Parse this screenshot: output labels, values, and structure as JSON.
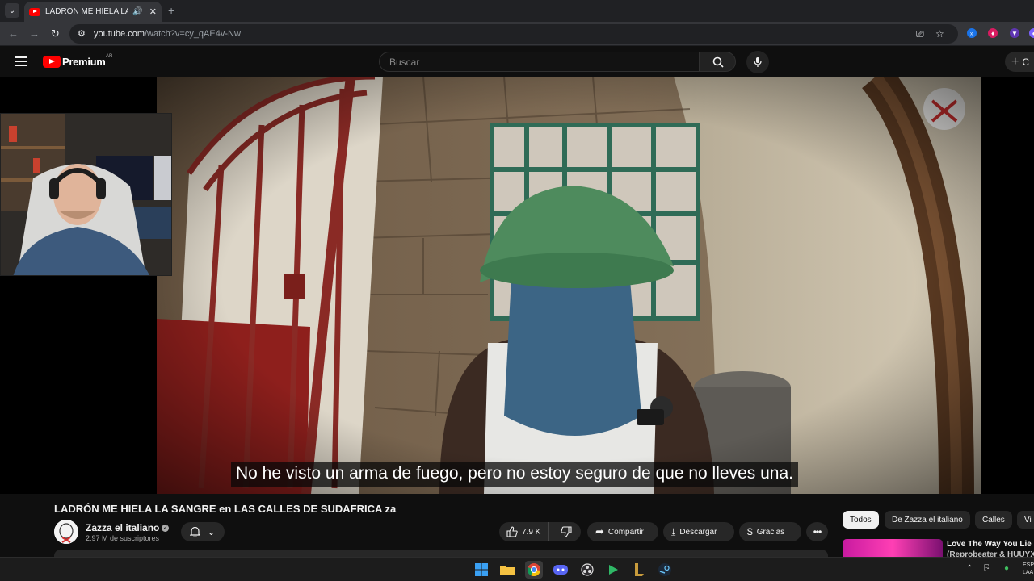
{
  "browser": {
    "tab_title": "LADRÓN ME HIELA LA SANGRE",
    "url_domain": "youtube.com",
    "url_path": "/watch?v=cy_qAE4v-Nw"
  },
  "youtube": {
    "brand": "Premium",
    "country": "AR",
    "search_placeholder": "Buscar",
    "create_label": "C"
  },
  "video": {
    "subtitle": "No he visto un arma de fuego, pero no estoy seguro de que no lleves una.",
    "title": "LADRÓN ME HIELA LA SANGRE en LAS CALLES DE SUDAFRICA",
    "title_suffix": "za"
  },
  "channel": {
    "name": "Zazza el italiano",
    "subscribers": "2.97 M de suscriptores"
  },
  "actions": {
    "likes": "7.9 K",
    "share": "Compartir",
    "download": "Descargar",
    "thanks": "Gracias",
    "more": "•••"
  },
  "chips": [
    "Todos",
    "De Zazza el italiano",
    "Calles",
    "Vi"
  ],
  "recommendation": {
    "title_line1": "Love The Way You Lie",
    "title_line2": "(Reprobeater & HUUYX"
  },
  "taskbar": {
    "lang_line1": "ESP",
    "lang_line2": "LAA"
  },
  "colors": {
    "yt_red": "#ff0000",
    "bg": "#0f0f0f",
    "pill": "#272727"
  }
}
